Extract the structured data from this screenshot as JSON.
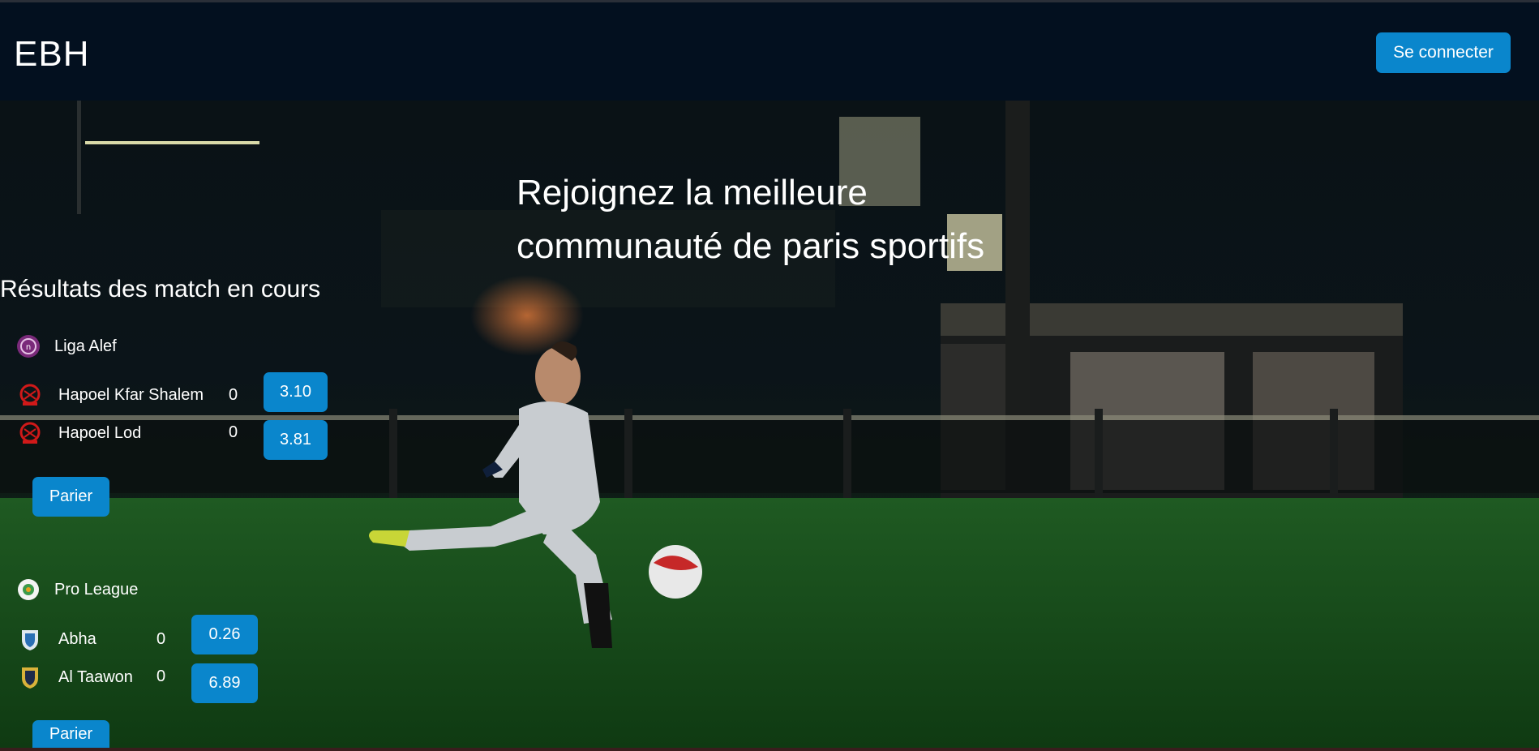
{
  "header": {
    "brand": "EBH",
    "login_label": "Se connecter"
  },
  "hero": {
    "headline_line1": "Rejoignez la meilleure",
    "headline_line2": "communauté de paris sportifs"
  },
  "live": {
    "title": "Résultats des match en cours",
    "matches": [
      {
        "league": "Liga Alef",
        "league_icon": "liga-alef-logo-icon",
        "home": {
          "name": "Hapoel Kfar Shalem",
          "score": "0",
          "odd": "3.10",
          "icon": "hapoel-crest-icon"
        },
        "away": {
          "name": "Hapoel Lod",
          "score": "0",
          "odd": "3.81",
          "icon": "hapoel-crest-icon"
        },
        "bet_label": "Parier"
      },
      {
        "league": "Pro League",
        "league_icon": "pro-league-logo-icon",
        "home": {
          "name": "Abha",
          "score": "0",
          "odd": "0.26",
          "icon": "abha-crest-icon"
        },
        "away": {
          "name": "Al Taawon",
          "score": "0",
          "odd": "6.89",
          "icon": "al-taawon-crest-icon"
        },
        "bet_label": "Parier"
      }
    ]
  },
  "colors": {
    "navbar_bg": "#03101f",
    "accent_button": "#0a86cc",
    "text": "#ffffff"
  }
}
